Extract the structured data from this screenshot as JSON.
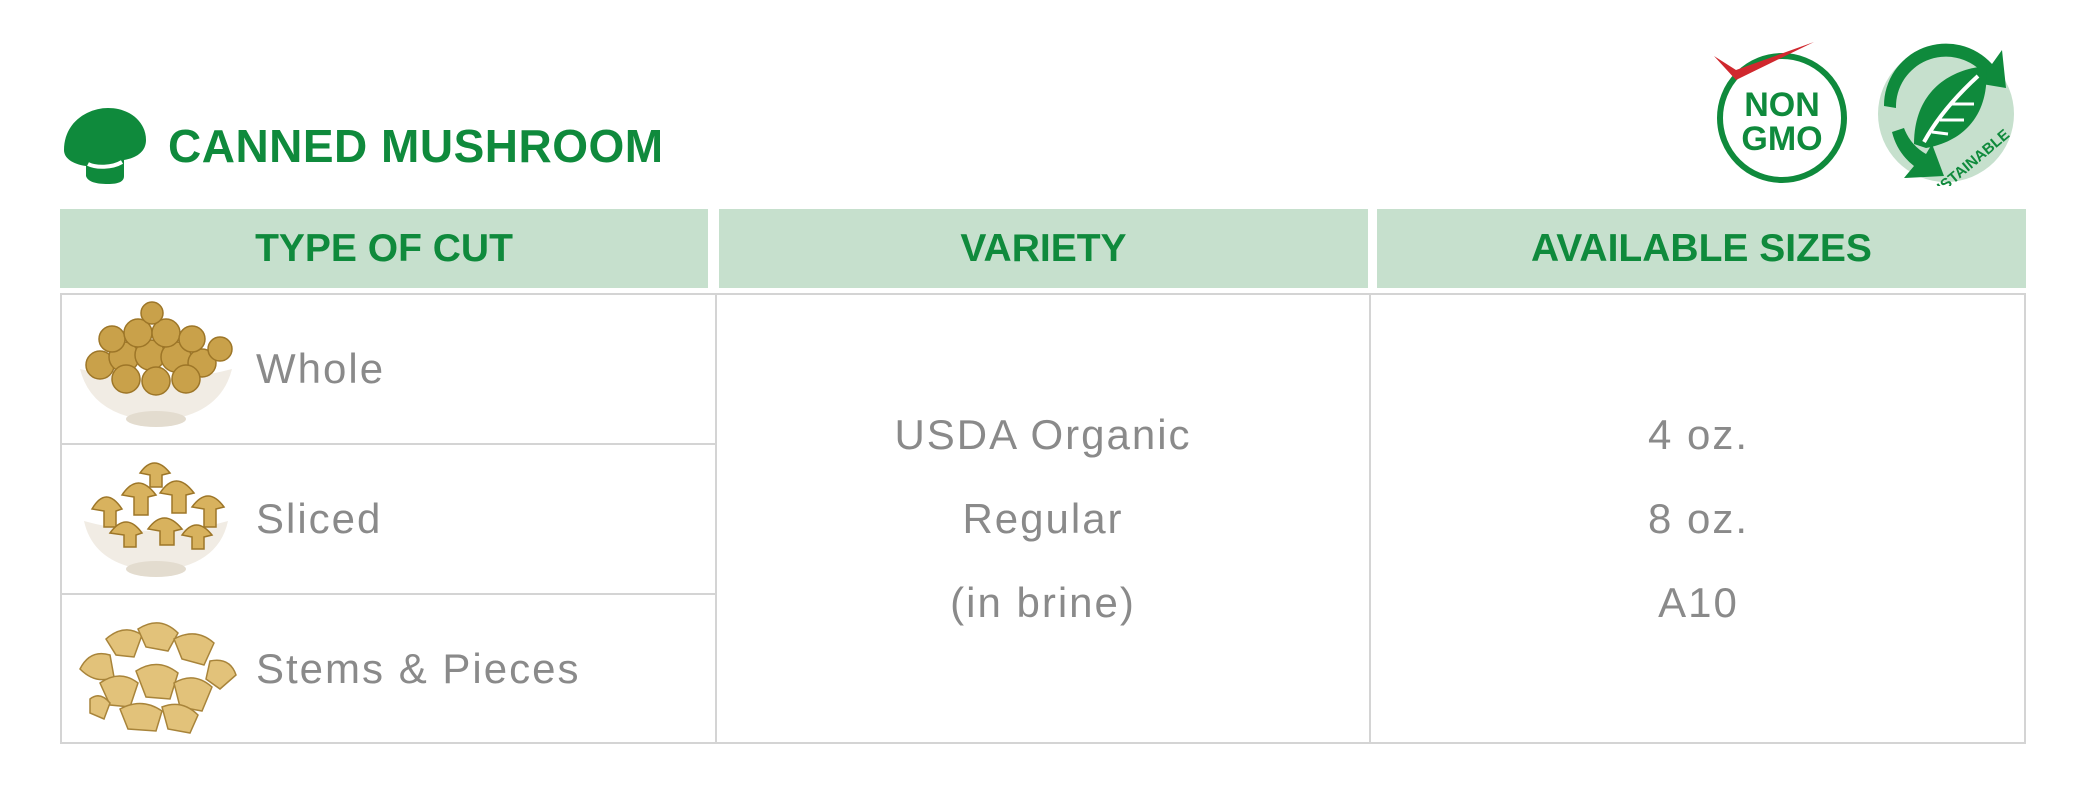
{
  "title": "CANNED MUSHROOM",
  "icons": {
    "title_icon": "mushroom-icon",
    "badge_non_gmo": "non-gmo-badge-icon",
    "badge_sustainable": "sustainable-leaf-badge-icon"
  },
  "badges": {
    "non_gmo_line1": "NON",
    "non_gmo_line2": "GMO",
    "sustainable": "SUSTAINABLE"
  },
  "colors": {
    "brand_green": "#0f8a3c",
    "header_fill": "#c6e0cd",
    "body_text": "#8a8a8a",
    "check_red": "#d0282e"
  },
  "headers": {
    "type_of_cut": "TYPE OF CUT",
    "variety": "VARIETY",
    "available_sizes": "AVAILABLE SIZES"
  },
  "cuts": [
    {
      "label": "Whole",
      "image": "whole-mushrooms-bowl"
    },
    {
      "label": "Sliced",
      "image": "sliced-mushrooms-bowl"
    },
    {
      "label": "Stems & Pieces",
      "image": "mushroom-stems-pieces"
    }
  ],
  "variety": [
    "USDA Organic",
    "Regular",
    "(in brine)"
  ],
  "sizes": [
    "4 oz.",
    "8 oz.",
    "A10"
  ]
}
